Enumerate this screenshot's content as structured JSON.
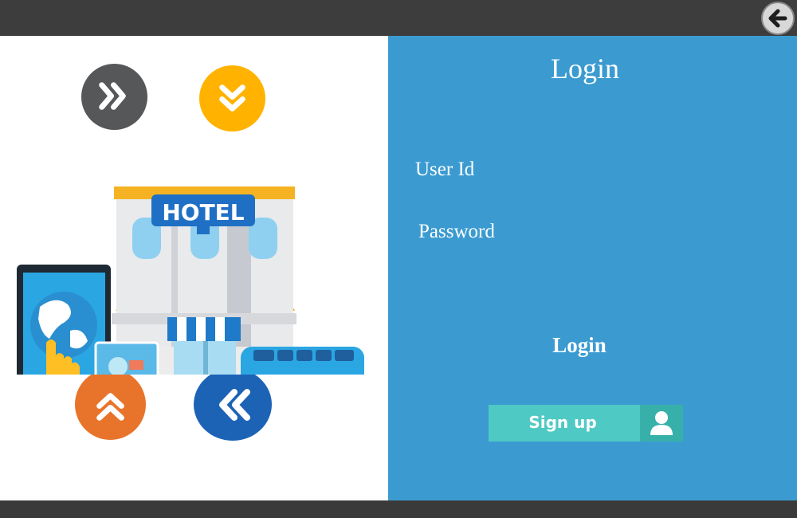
{
  "toolbar": {
    "back_icon": "arrow-left-icon"
  },
  "illustration": {
    "hotel_sign": "HOTEL",
    "nav_buttons": [
      {
        "name": "double-chevron-right-icon",
        "color": "#555759"
      },
      {
        "name": "double-chevron-down-icon",
        "color": "#ffb300"
      },
      {
        "name": "double-chevron-up-icon",
        "color": "#e8742c"
      },
      {
        "name": "double-chevron-left-icon",
        "color": "#1c63b6"
      }
    ]
  },
  "login": {
    "title": "Login",
    "user_id_label": "User Id",
    "password_label": "Password",
    "user_id_value": "",
    "password_value": "",
    "login_button": "Login",
    "signup_button": "Sign up",
    "signup_icon": "user-icon"
  },
  "colors": {
    "panel": "#3b9bd1",
    "signup": "#4ec9c3",
    "topbar": "#3d3d3d"
  }
}
